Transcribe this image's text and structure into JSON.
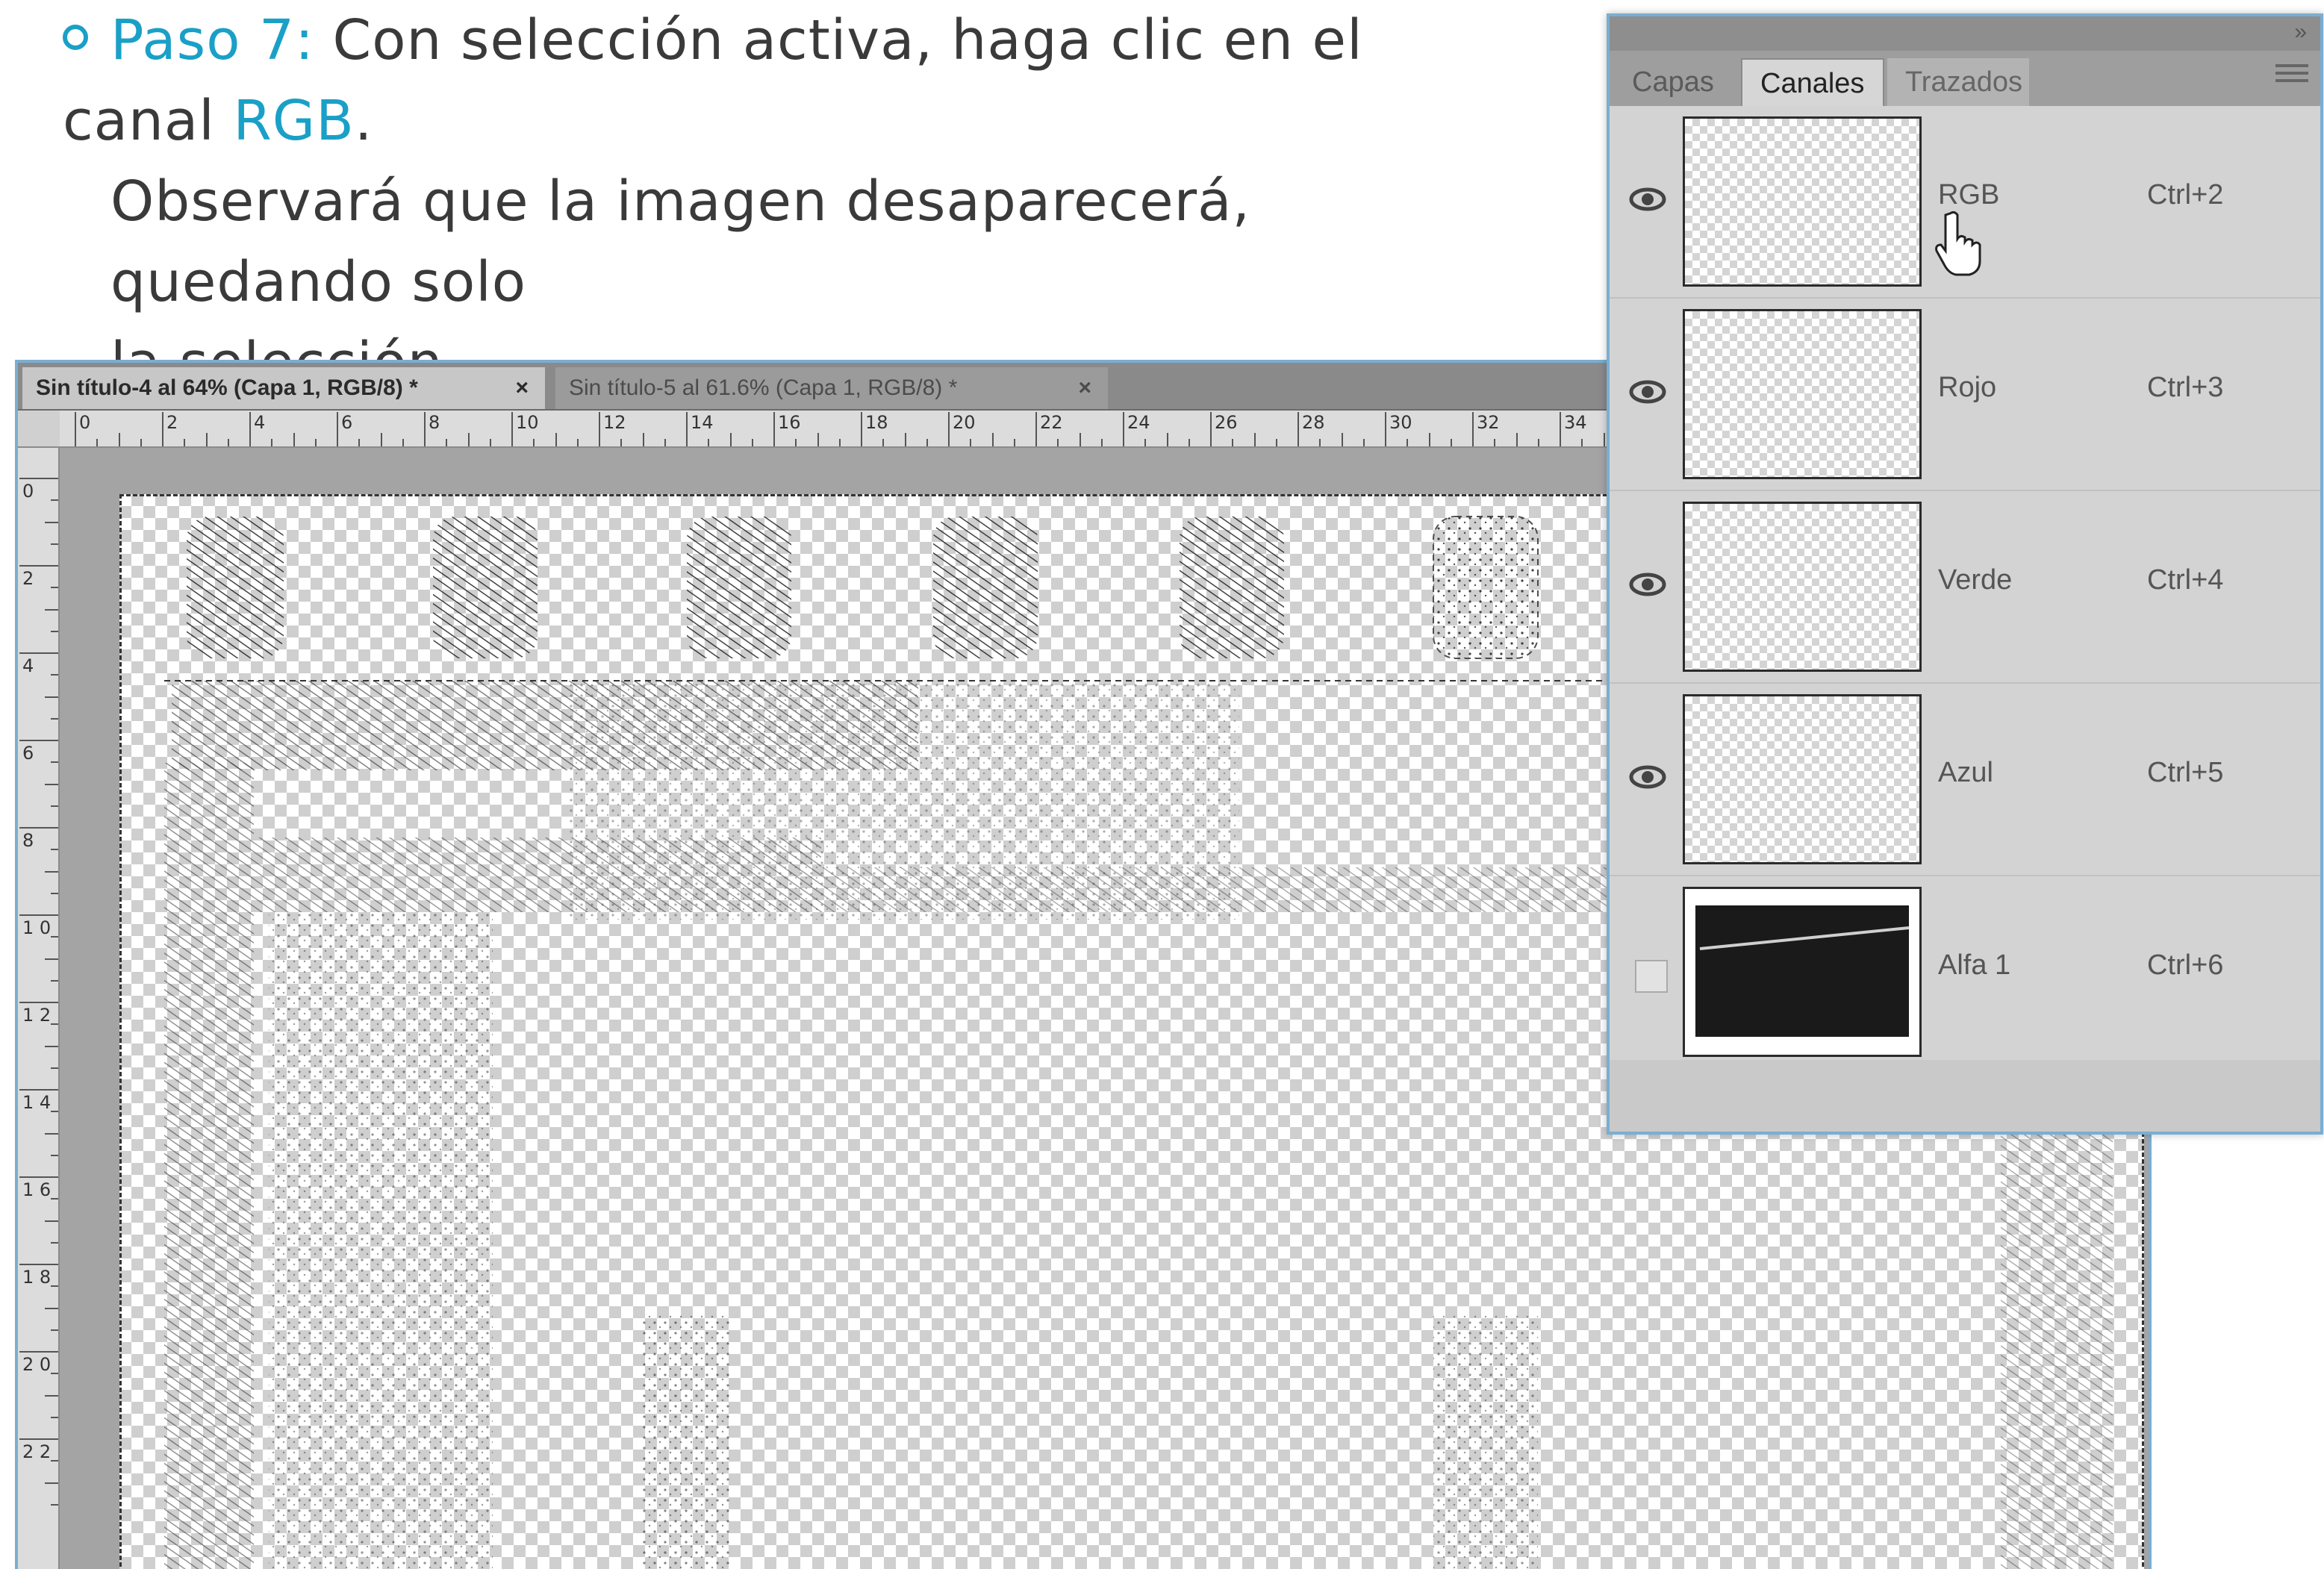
{
  "instruction": {
    "step_label": "Paso 7:",
    "line1_text": " Con selección activa, haga clic en el canal ",
    "line1_highlight": "RGB",
    "line1_end": ".",
    "line2": "Observará que la imagen desaparecerá, quedando solo",
    "line3": "la selección."
  },
  "document": {
    "tabs": [
      {
        "label": "Sin título-4 al 64% (Capa 1, RGB/8) *",
        "close": "×"
      },
      {
        "label": "Sin título-5 al 61.6% (Capa 1, RGB/8) *",
        "close": "×"
      }
    ],
    "ruler_h": [
      "0",
      "2",
      "4",
      "6",
      "8",
      "10",
      "12",
      "14",
      "16",
      "18",
      "20",
      "22",
      "24",
      "26",
      "28",
      "30",
      "32",
      "34"
    ],
    "ruler_v": [
      "0",
      "2",
      "4",
      "6",
      "8",
      "1 0",
      "1 2",
      "1 4",
      "1 6",
      "1 8",
      "2 0",
      "2 2"
    ]
  },
  "panel": {
    "tabs": [
      "Capas",
      "Canales",
      "Trazados"
    ],
    "active_tab": "Canales",
    "channels": [
      {
        "name": "RGB",
        "shortcut": "Ctrl+2",
        "visible": true
      },
      {
        "name": "Rojo",
        "shortcut": "Ctrl+3",
        "visible": true
      },
      {
        "name": "Verde",
        "shortcut": "Ctrl+4",
        "visible": true
      },
      {
        "name": "Azul",
        "shortcut": "Ctrl+5",
        "visible": true
      },
      {
        "name": "Alfa 1",
        "shortcut": "Ctrl+6",
        "visible": false
      }
    ]
  },
  "colors": {
    "accent": "#1aa0c7",
    "window_border": "#7aaed2"
  }
}
